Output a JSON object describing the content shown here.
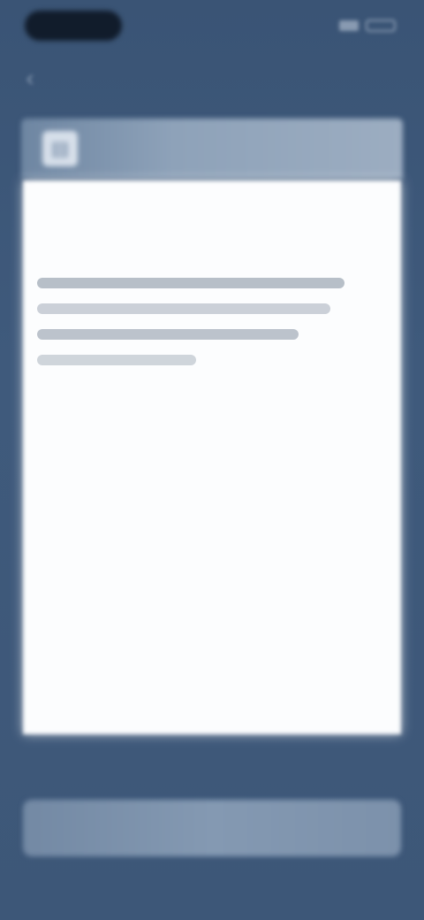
{
  "status_bar": {
    "time": ""
  },
  "nav": {
    "title": ""
  },
  "panel": {
    "header_icon": "document-icon"
  },
  "content": {
    "lines": [
      "",
      "",
      "",
      ""
    ]
  },
  "action": {
    "label": ""
  },
  "colors": {
    "background": "#3c5676",
    "header": "#8ea2b9",
    "card": "#fcfdfe",
    "button": "#8499b2"
  }
}
